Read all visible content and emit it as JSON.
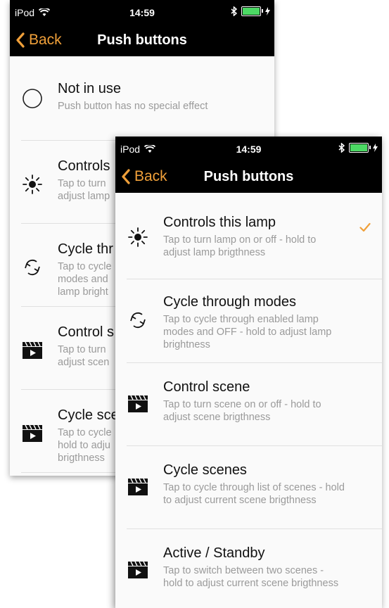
{
  "status": {
    "carrier": "iPod",
    "time": "14:59"
  },
  "nav": {
    "back_label": "Back",
    "title": "Push buttons"
  },
  "accent_color": "#f0a03a",
  "back_screen": {
    "items": [
      {
        "label": "Not in use",
        "desc": "Push button has no special effect",
        "icon": "circle-icon"
      },
      {
        "label": "Controls",
        "desc": "Tap to turn\nadjust lamp",
        "icon": "sun-icon"
      },
      {
        "label": "Cycle thr",
        "desc": "Tap to cycle\nmodes and\nlamp bright",
        "icon": "cycle-icon"
      },
      {
        "label": "Control s",
        "desc": "Tap to turn\nadjust scen",
        "icon": "clapper-icon"
      },
      {
        "label": "Cycle sce",
        "desc": "Tap to cycle\nhold to adju\nbrigthness",
        "icon": "clapper-icon"
      }
    ]
  },
  "front_screen": {
    "selected_index": 0,
    "items": [
      {
        "label": "Controls this lamp",
        "desc": "Tap to turn lamp on or off - hold to adjust lamp brigthness",
        "icon": "sun-icon"
      },
      {
        "label": "Cycle through modes",
        "desc": "Tap to cycle through enabled lamp modes and OFF - hold to adjust lamp brightness",
        "icon": "cycle-icon"
      },
      {
        "label": "Control scene",
        "desc": "Tap to turn scene on or off - hold to adjust scene brigthness",
        "icon": "clapper-icon"
      },
      {
        "label": "Cycle scenes",
        "desc": "Tap to cycle through list of scenes - hold to adjust current scene brigthness",
        "icon": "clapper-icon"
      },
      {
        "label": "Active / Standby",
        "desc": "Tap to switch between two scenes - hold to adjust current scene brigthness",
        "icon": "clapper-icon"
      }
    ]
  }
}
